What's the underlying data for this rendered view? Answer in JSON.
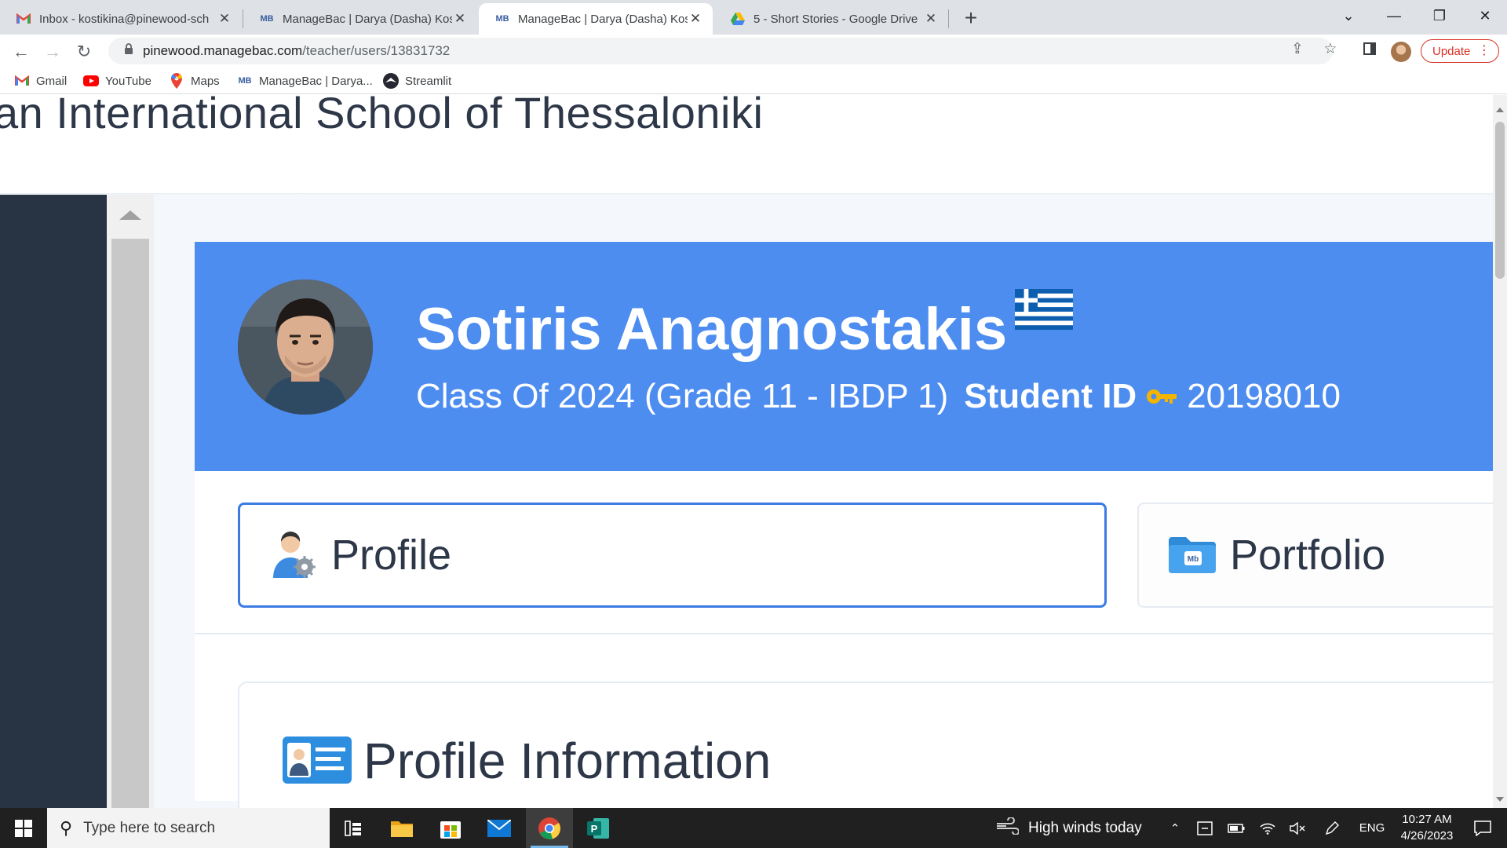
{
  "browser": {
    "tabs": [
      {
        "title": "Inbox - kostikina@pinewood-sch",
        "favicon": "gmail-icon",
        "active": false
      },
      {
        "title": "ManageBac | Darya (Dasha) Kosti",
        "favicon": "managebac-icon",
        "active": false
      },
      {
        "title": "ManageBac | Darya (Dasha) Kosti",
        "favicon": "managebac-icon",
        "active": true
      },
      {
        "title": "5 - Short Stories - Google Drive",
        "favicon": "google-drive-icon",
        "active": false
      }
    ],
    "url_host": "pinewood.managebac.com",
    "url_path": "/teacher/users/13831732",
    "update_label": "Update",
    "bookmarks": [
      {
        "label": "Gmail",
        "icon": "gmail-icon"
      },
      {
        "label": "YouTube",
        "icon": "youtube-icon"
      },
      {
        "label": "Maps",
        "icon": "maps-icon"
      },
      {
        "label": "ManageBac | Darya...",
        "icon": "managebac-icon"
      },
      {
        "label": "Streamlit",
        "icon": "streamlit-icon"
      }
    ]
  },
  "page": {
    "school_title": "an International School of Thessaloniki",
    "student": {
      "name": "Sotiris Anagnostakis",
      "class_line": "Class Of 2024 (Grade 11 - IBDP 1)",
      "student_id_label": "Student ID",
      "student_id": "20198010",
      "flag": "greece-flag-icon"
    },
    "tabs": [
      {
        "label": "Profile",
        "icon": "user-settings-icon",
        "selected": true
      },
      {
        "label": "Portfolio",
        "icon": "portfolio-folder-icon",
        "selected": false
      }
    ],
    "section_title": "Profile Information",
    "colors": {
      "hero_bg": "#4e8df0",
      "sidebar_bg": "#283444",
      "selected_border": "#3b7be3"
    }
  },
  "taskbar": {
    "search_placeholder": "Type here to search",
    "weather": "High winds today",
    "language": "ENG",
    "time": "10:27 AM",
    "date": "4/26/2023"
  }
}
